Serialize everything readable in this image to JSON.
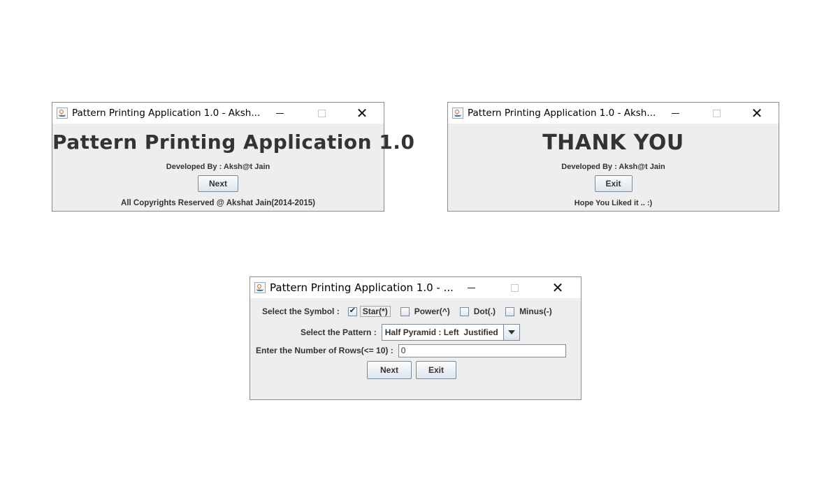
{
  "windows": {
    "welcome": {
      "title": "Pattern Printing Application 1.0 - Aksh...",
      "heading": "Pattern Printing Application 1.0",
      "developer": "Developed By : Aksh@t Jain",
      "next_label": "Next",
      "footer": "All Copyrights Reserved @ Akshat Jain(2014-2015)"
    },
    "thanks": {
      "title": "Pattern Printing Application 1.0 - Aksh...",
      "heading": "THANK YOU",
      "developer": "Developed By : Aksh@t Jain",
      "exit_label": "Exit",
      "footer": "Hope You Liked it .. :)"
    },
    "form": {
      "title": "Pattern Printing Application 1.0 - ...",
      "symbol_label": "Select the Symbol :",
      "symbols": [
        {
          "label": "Star(*)",
          "checked": true
        },
        {
          "label": "Power(^)",
          "checked": false
        },
        {
          "label": "Dot(.)",
          "checked": false
        },
        {
          "label": "Minus(-)",
          "checked": false
        }
      ],
      "pattern_label": "Select the Pattern :",
      "pattern_selected": "Half Pyramid : Left  Justified",
      "rows_label": "Enter the Number of Rows(<= 10) :",
      "rows_value": "0",
      "next_label": "Next",
      "exit_label": "Exit"
    }
  },
  "colors": {
    "window_bg": "#eeeeee",
    "titlebar_bg": "#ffffff",
    "border": "#8c8c8c",
    "text": "#333333"
  }
}
